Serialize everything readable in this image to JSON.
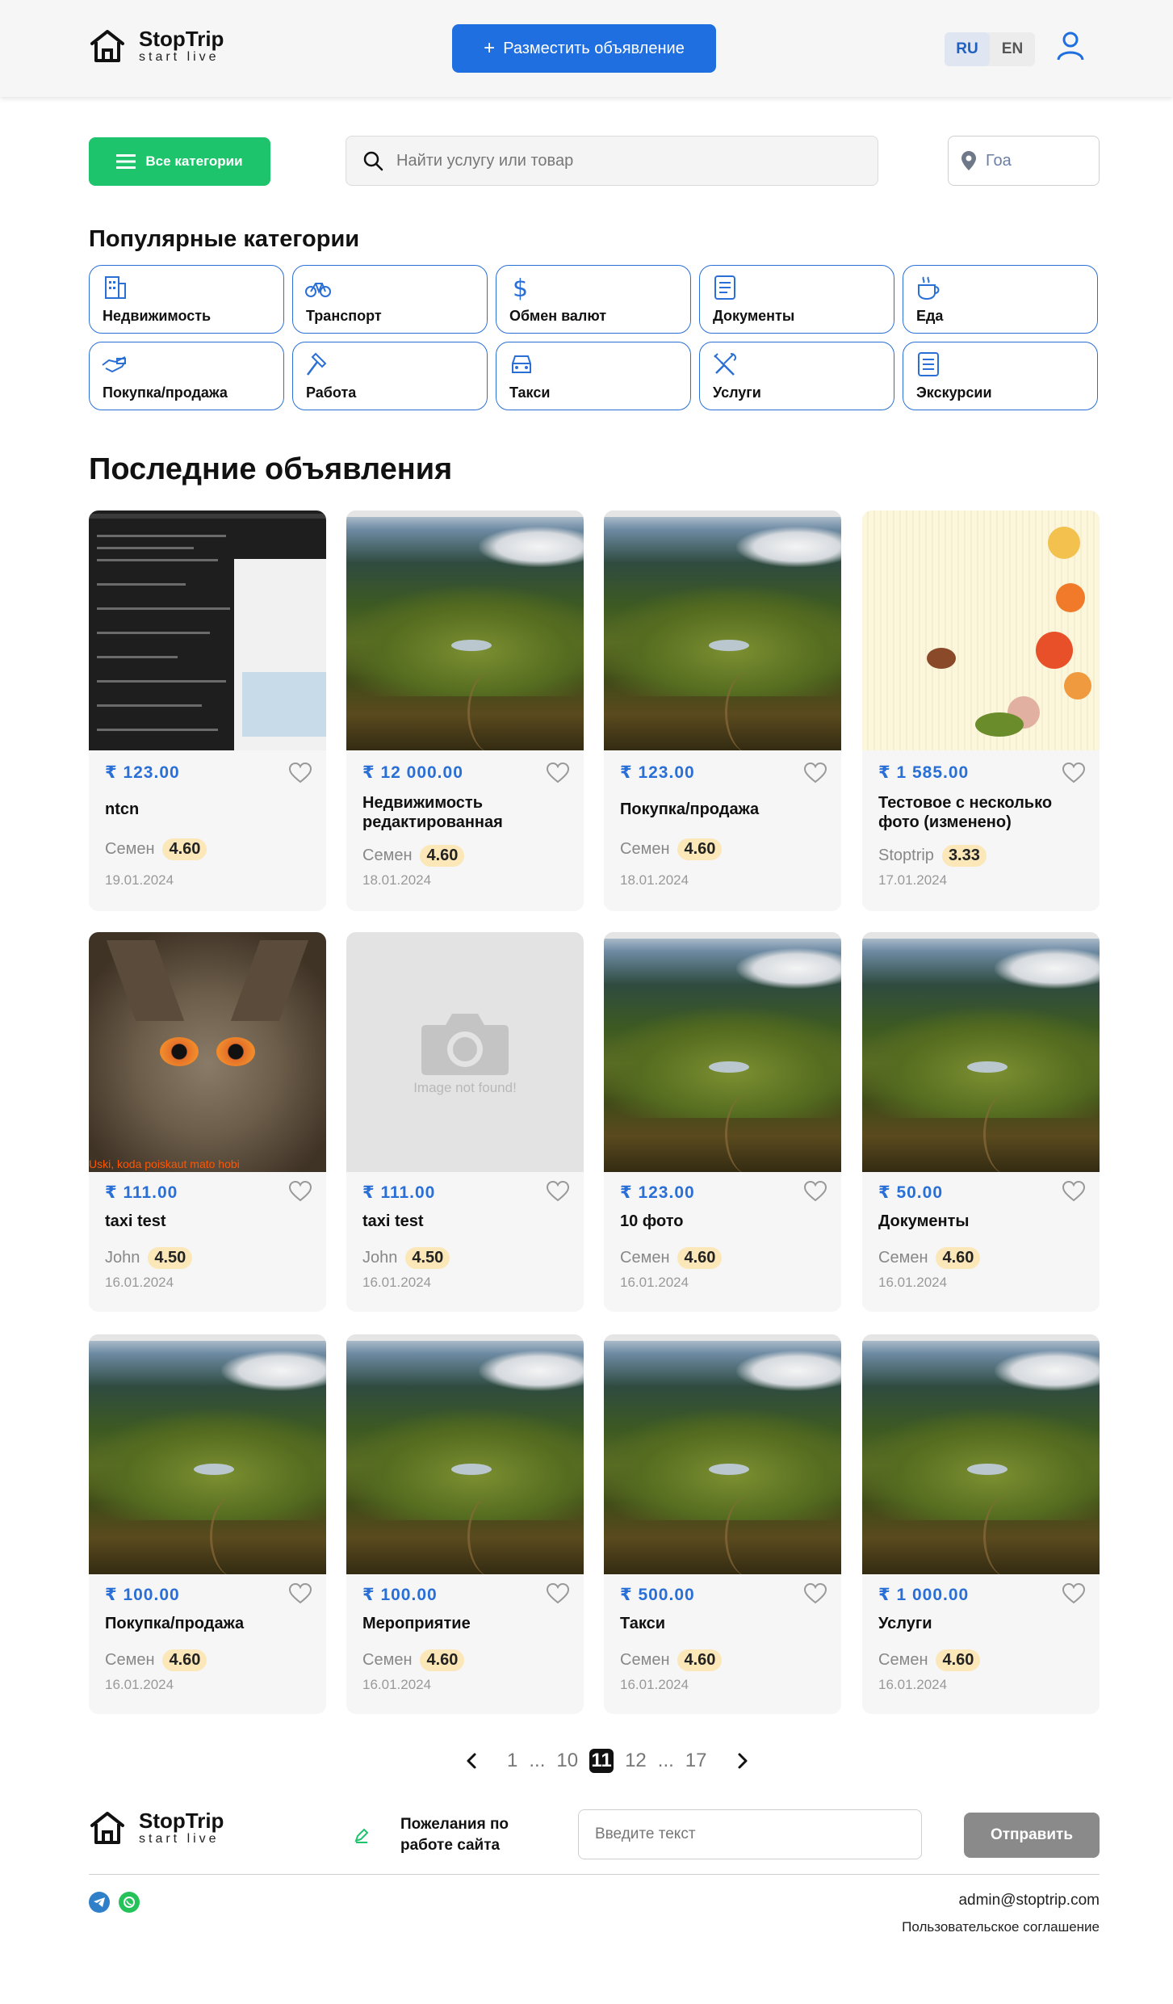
{
  "header": {
    "brand": "StopTrip",
    "tagline": "start live",
    "post_button": "Разместить объявление",
    "lang_ru": "RU",
    "lang_en": "EN"
  },
  "filters": {
    "categories_button": "Все категории",
    "search_placeholder": "Найти услугу или товар",
    "location": "Гоа"
  },
  "popular": {
    "title": "Популярные категории",
    "items": [
      {
        "label": "Недвижимость",
        "icon": "building-icon"
      },
      {
        "label": "Транспорт",
        "icon": "bicycle-icon"
      },
      {
        "label": "Обмен валют",
        "icon": "dollar-icon"
      },
      {
        "label": "Документы",
        "icon": "document-icon"
      },
      {
        "label": "Еда",
        "icon": "coffee-cup-icon"
      },
      {
        "label": "Покупка/продажа",
        "icon": "handshake-icon"
      },
      {
        "label": "Работа",
        "icon": "hammer-icon"
      },
      {
        "label": "Такси",
        "icon": "car-icon"
      },
      {
        "label": "Услуги",
        "icon": "tools-icon"
      },
      {
        "label": "Экскурсии",
        "icon": "list-icon"
      }
    ]
  },
  "listings": {
    "title": "Последние объявления",
    "cards": [
      {
        "price": "₹ 123.00",
        "title": "ntcn",
        "seller": "Семен",
        "rating": "4.60",
        "date": "19.01.2024",
        "image": "screenshot"
      },
      {
        "price": "₹ 12 000.00",
        "title": "Недвижимость редактированная",
        "seller": "Семен",
        "rating": "4.60",
        "date": "18.01.2024",
        "image": "landscape"
      },
      {
        "price": "₹ 123.00",
        "title": "Покупка/продажа",
        "seller": "Семен",
        "rating": "4.60",
        "date": "18.01.2024",
        "image": "landscape"
      },
      {
        "price": "₹ 1 585.00",
        "title": "Тестовое с несколько фото (изменено)",
        "seller": "Stoptrip",
        "rating": "3.33",
        "date": "17.01.2024",
        "image": "butterfly"
      },
      {
        "price": "₹ 111.00",
        "title": "taxi test",
        "seller": "John",
        "rating": "4.50",
        "date": "16.01.2024",
        "image": "owl",
        "image_caption": "Uski, koda poiskaut mato hobi"
      },
      {
        "price": "₹ 111.00",
        "title": "taxi test",
        "seller": "John",
        "rating": "4.50",
        "date": "16.01.2024",
        "image": "none",
        "image_caption": "Image not found!"
      },
      {
        "price": "₹ 123.00",
        "title": "10 фото",
        "seller": "Семен",
        "rating": "4.60",
        "date": "16.01.2024",
        "image": "landscape"
      },
      {
        "price": "₹ 50.00",
        "title": "Документы",
        "seller": "Семен",
        "rating": "4.60",
        "date": "16.01.2024",
        "image": "landscape"
      },
      {
        "price": "₹ 100.00",
        "title": "Покупка/продажа",
        "seller": "Семен",
        "rating": "4.60",
        "date": "16.01.2024",
        "image": "landscape"
      },
      {
        "price": "₹ 100.00",
        "title": "Мероприятие",
        "seller": "Семен",
        "rating": "4.60",
        "date": "16.01.2024",
        "image": "landscape"
      },
      {
        "price": "₹ 500.00",
        "title": "Такси",
        "seller": "Семен",
        "rating": "4.60",
        "date": "16.01.2024",
        "image": "landscape"
      },
      {
        "price": "₹ 1 000.00",
        "title": "Услуги",
        "seller": "Семен",
        "rating": "4.60",
        "date": "16.01.2024",
        "image": "landscape"
      }
    ]
  },
  "pagination": {
    "pages": [
      "1",
      "...",
      "10",
      "11",
      "12",
      "...",
      "17"
    ],
    "current": "11"
  },
  "footer": {
    "brand": "StopTrip",
    "tagline": "start live",
    "wish_label": "Пожелания по работе сайта",
    "wish_placeholder": "Введите текст",
    "send_button": "Отправить",
    "email": "admin@stoptrip.com",
    "agreement": "Пользовательское соглашение"
  },
  "colors": {
    "accent_blue": "#1f6fe0",
    "green": "#1ec46b",
    "rating_bg": "#fbe7b8"
  }
}
